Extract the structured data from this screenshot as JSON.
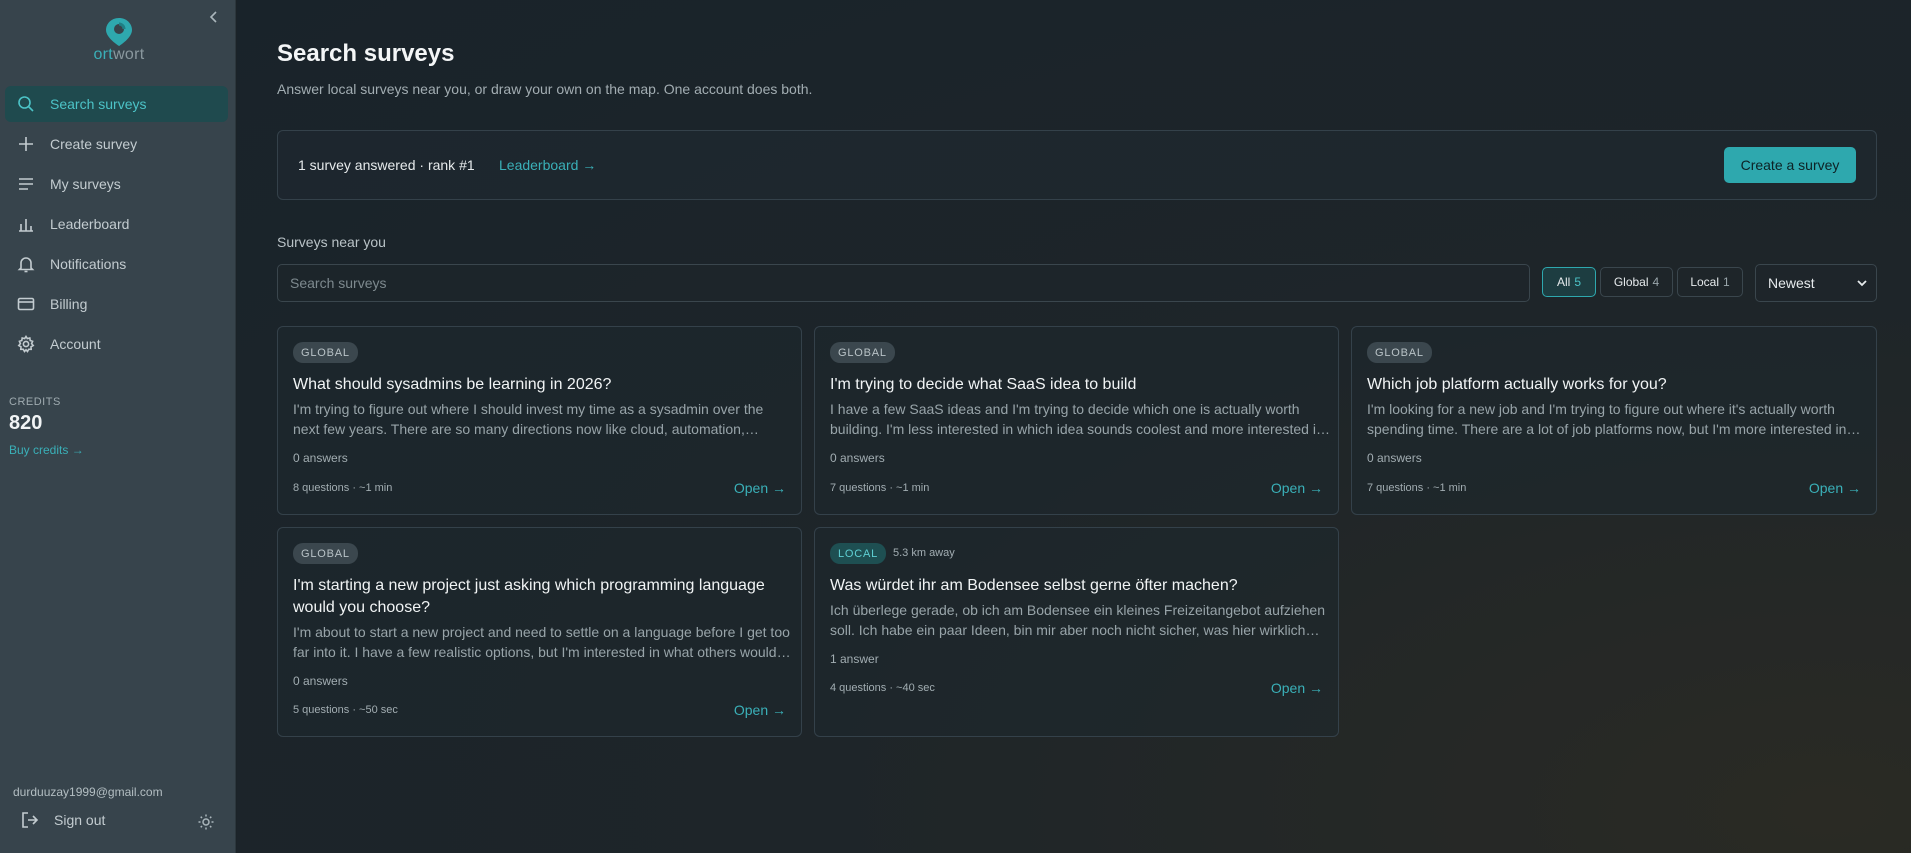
{
  "app": {
    "logo_text_a": "ort",
    "logo_text_b": "wort",
    "accent_color": "#2ea8ae"
  },
  "sidebar": {
    "collapse_icon": "chevron-left-icon",
    "items": [
      {
        "label": "Search surveys",
        "icon": "search-icon",
        "active": true
      },
      {
        "label": "Create survey",
        "icon": "plus-icon"
      },
      {
        "label": "My surveys",
        "icon": "list-icon"
      },
      {
        "label": "Leaderboard",
        "icon": "bar-chart-icon"
      },
      {
        "label": "Notifications",
        "icon": "bell-icon"
      },
      {
        "label": "Billing",
        "icon": "credit-card-icon"
      },
      {
        "label": "Account",
        "icon": "gear-icon"
      }
    ],
    "credits_label": "CREDITS",
    "credits_value": "820",
    "buy_credits": "Buy credits →",
    "user_email": "durduuzay1999@gmail.com",
    "sign_out": "Sign out"
  },
  "header": {
    "title": "Search surveys",
    "subtitle": "Answer local surveys near you, or draw your own on the map. One account does both."
  },
  "stats": {
    "text": "1 survey answered · rank #1",
    "leaderboard_link": "Leaderboard →",
    "create_button": "Create a survey"
  },
  "surveys_section": {
    "label": "Surveys near you",
    "search_placeholder": "Search surveys",
    "filters": [
      {
        "label": "All",
        "count": "5",
        "active": true
      },
      {
        "label": "Global",
        "count": "4"
      },
      {
        "label": "Local",
        "count": "1"
      }
    ],
    "sort_value": "Newest"
  },
  "cards": [
    {
      "badge": "GLOBAL",
      "title": "What should sysadmins be learning in 2026?",
      "description": "I'm trying to figure out where I should invest my time as a sysadmin over the next few years. There are so many directions now like cloud, automation, security, containers, and more.",
      "answers": "0 answers",
      "meta": "8 questions · ~1 min",
      "open": "Open →"
    },
    {
      "badge": "GLOBAL",
      "title": "I'm trying to decide what SaaS idea to build",
      "description": "I have a few SaaS ideas and I'm trying to decide which one is actually worth building. I'm less interested in which idea sounds coolest and more interested in what people would pay for.",
      "answers": "0 answers",
      "meta": "7 questions · ~1 min",
      "open": "Open →"
    },
    {
      "badge": "GLOBAL",
      "title": "Which job platform actually works for you?",
      "description": "I'm looking for a new job and I'm trying to figure out where it's actually worth spending time. There are a lot of job platforms now, but I'm more interested in what actually works.",
      "answers": "0 answers",
      "meta": "7 questions · ~1 min",
      "open": "Open →"
    },
    {
      "badge": "GLOBAL",
      "title": "I'm starting a new project just asking which programming language would you choose?",
      "description": "I'm about to start a new project and need to settle on a language before I get too far into it. I have a few realistic options, but I'm interested in what others would pick and why.",
      "answers": "0 answers",
      "meta": "5 questions · ~50 sec",
      "open": "Open →"
    },
    {
      "badge": "LOCAL",
      "distance": "5.3 km away",
      "title": "Was würdet ihr am Bodensee selbst gerne öfter machen?",
      "description": "Ich überlege gerade, ob ich am Bodensee ein kleines Freizeitangebot aufziehen soll. Ich habe ein paar Ideen, bin mir aber noch nicht sicher, was hier wirklich gefragt ist.",
      "answers": "1 answer",
      "meta": "4 questions · ~40 sec",
      "open": "Open →"
    }
  ]
}
